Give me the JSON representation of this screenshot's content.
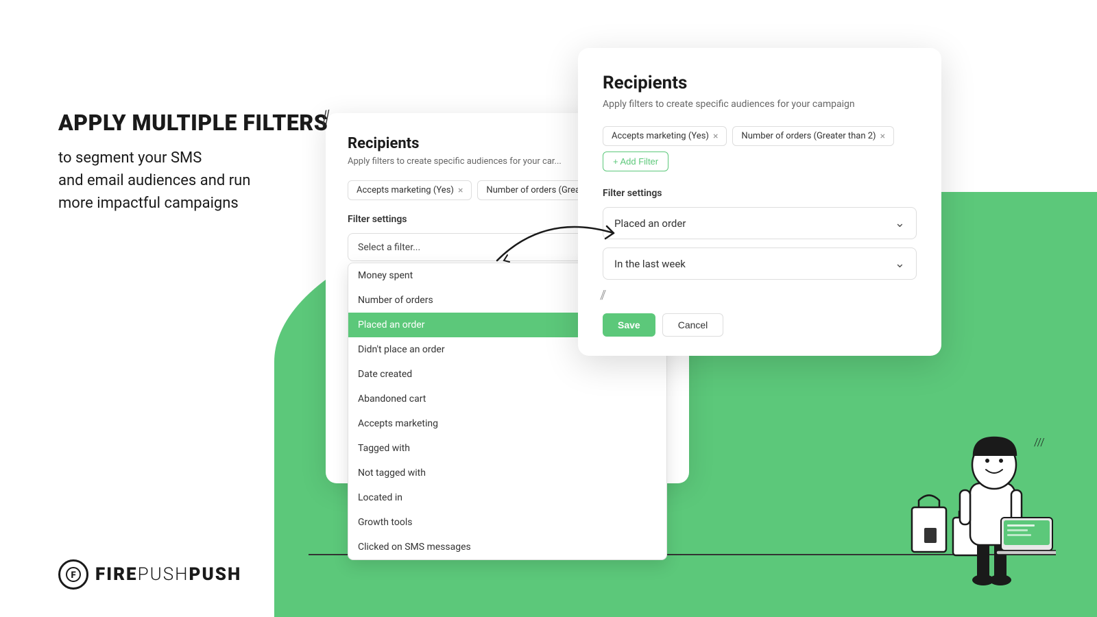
{
  "leftContent": {
    "heading": "APPLY MULTIPLE FILTERS",
    "subtext": "to segment your SMS\nand email audiences and run\nmore impactful campaigns"
  },
  "logo": {
    "iconText": "F",
    "text": "FIRE",
    "textLight": "PUSH"
  },
  "backgroundCard": {
    "title": "Recipients",
    "subtitle": "Apply filters to create specific audiences for your car...",
    "filterTags": [
      {
        "label": "Accepts marketing (Yes)",
        "hasX": true
      },
      {
        "label": "Number of orders (Greater...",
        "hasX": false
      }
    ],
    "filterSettingsLabel": "Filter settings",
    "dropdown": {
      "placeholder": "Select a filter...",
      "items": [
        {
          "label": "Money spent",
          "selected": false
        },
        {
          "label": "Number of orders",
          "selected": false
        },
        {
          "label": "Placed an order",
          "selected": true
        },
        {
          "label": "Didn't place an order",
          "selected": false
        },
        {
          "label": "Date created",
          "selected": false
        },
        {
          "label": "Abandoned cart",
          "selected": false
        },
        {
          "label": "Accepts marketing",
          "selected": false
        },
        {
          "label": "Tagged with",
          "selected": false
        },
        {
          "label": "Not tagged with",
          "selected": false
        },
        {
          "label": "Located in",
          "selected": false
        },
        {
          "label": "Growth tools",
          "selected": false
        },
        {
          "label": "Clicked on SMS messages",
          "selected": false
        }
      ]
    }
  },
  "frontCard": {
    "title": "Recipients",
    "subtitle": "Apply filters to create specific audiences for your campaign",
    "filterTags": [
      {
        "label": "Accepts marketing (Yes)",
        "hasX": true
      },
      {
        "label": "Number of orders (Greater than 2)",
        "hasX": true
      }
    ],
    "addFilterLabel": "+ Add Filter",
    "filterSettingsLabel": "Filter settings",
    "dropdown1": {
      "value": "Placed an order"
    },
    "dropdown2": {
      "value": "In the last week"
    },
    "buttons": {
      "save": "Save",
      "cancel": "Cancel"
    }
  }
}
